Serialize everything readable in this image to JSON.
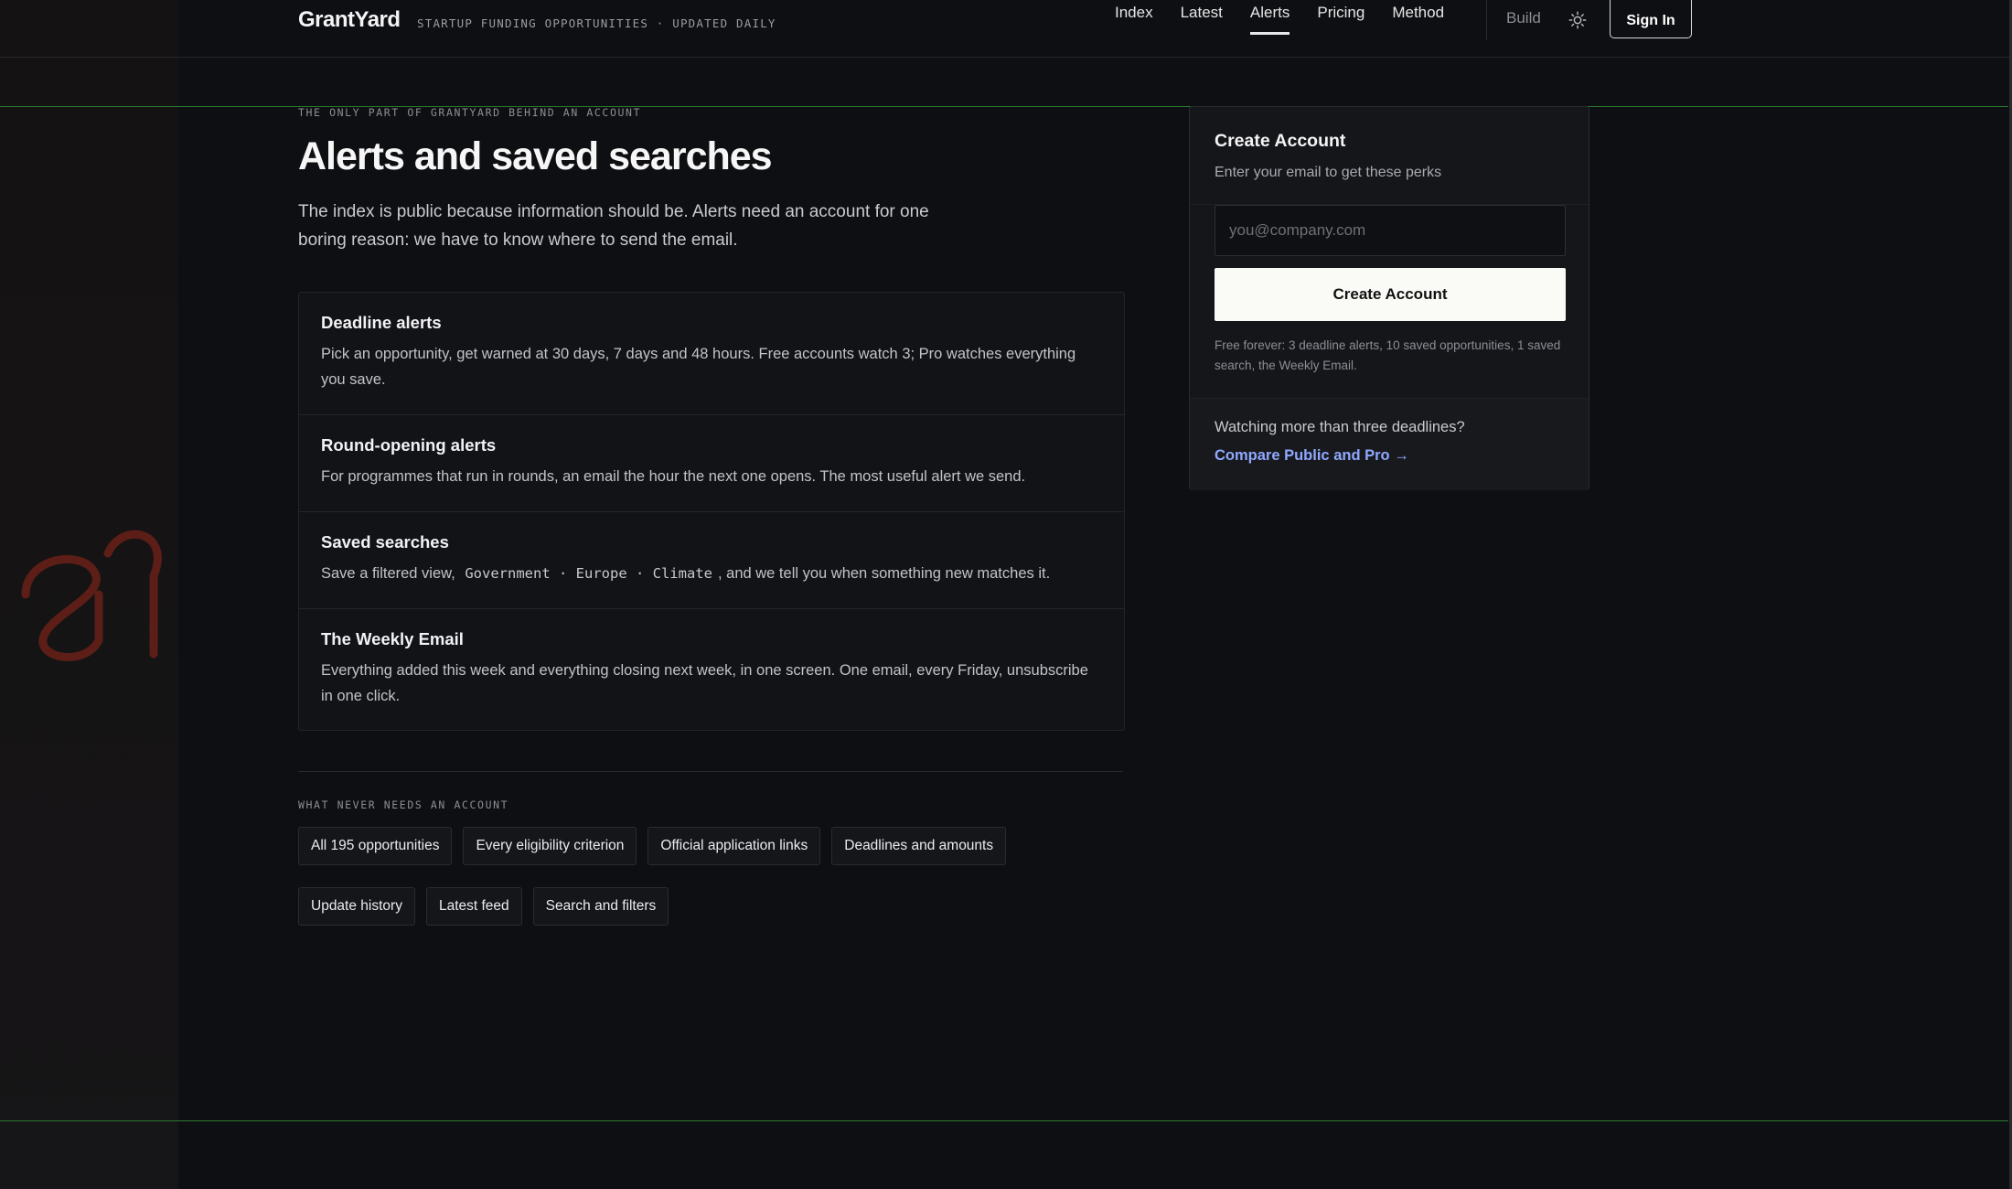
{
  "header": {
    "brand": "GrantYard",
    "tagline": "STARTUP FUNDING OPPORTUNITIES · UPDATED DAILY",
    "nav": [
      "Index",
      "Latest",
      "Alerts",
      "Pricing",
      "Method"
    ],
    "active_nav": "Alerts",
    "build_label": "Build",
    "sign_in_label": "Sign In"
  },
  "main": {
    "eyebrow": "THE ONLY PART OF GRANTYARD BEHIND AN ACCOUNT",
    "title": "Alerts and saved searches",
    "intro": "The index is public because information should be. Alerts need an account for one boring reason: we have to know where to send the email.",
    "features": [
      {
        "title": "Deadline alerts",
        "body": "Pick an opportunity, get warned at 30 days, 7 days and 48 hours. Free accounts watch 3; Pro watches everything you save."
      },
      {
        "title": "Round-opening alerts",
        "body": "For programmes that run in rounds, an email the hour the next one opens. The most useful alert we send."
      },
      {
        "title": "Saved searches",
        "body_before": "Save a filtered view,",
        "body_code": "Government · Europe · Climate",
        "body_after": ", and we tell you when something new matches it."
      },
      {
        "title": "The Weekly Email",
        "body": "Everything added this week and everything closing next week, in one screen. One email, every Friday, unsubscribe in one click."
      }
    ],
    "no_account_label": "WHAT NEVER NEEDS AN ACCOUNT",
    "chips_row1": [
      "All 195 opportunities",
      "Every eligibility criterion",
      "Official application links",
      "Deadlines and amounts"
    ],
    "chips_row2": [
      "Update history",
      "Latest feed",
      "Search and filters"
    ]
  },
  "signup": {
    "title": "Create Account",
    "subtitle": "Enter your email to get these perks",
    "email_placeholder": "you@company.com",
    "email_value": "",
    "button_label": "Create Account",
    "fine_print": "Free forever: 3 deadline alerts, 10 saved opportunities, 1 saved search, the Weekly Email.",
    "footer_question": "Watching more than three deadlines?",
    "footer_link": "Compare Public and Pro →"
  },
  "colors": {
    "background": "#0e0f12",
    "accent_link": "#8fa8ff",
    "guide_line": "#2b7a2f",
    "glyph": "#6e2118"
  },
  "icons": {
    "theme_toggle": "sun-icon",
    "decorative_glyph": "brand-glyph-icon"
  }
}
